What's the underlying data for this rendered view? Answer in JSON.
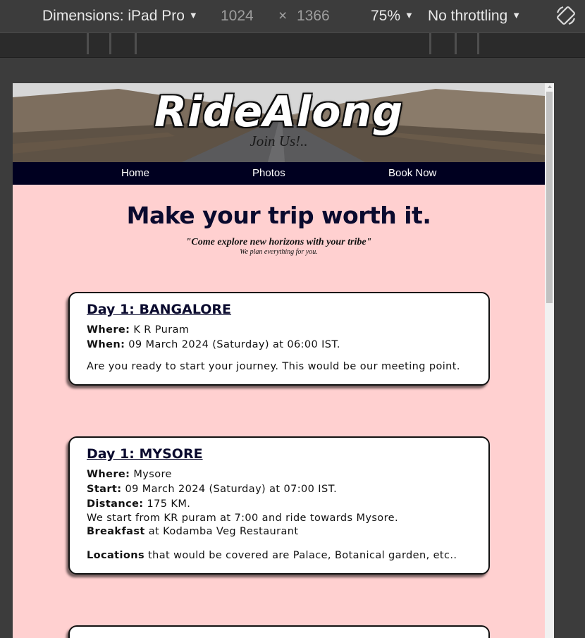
{
  "devtools": {
    "dimensions_label": "Dimensions: iPad Pro",
    "width": "1024",
    "times": "×",
    "height": "1366",
    "zoom": "75%",
    "throttling": "No throttling",
    "caret": "▼"
  },
  "site": {
    "brand": "RideAlong",
    "tagline": "Join Us!..",
    "nav": [
      "Home",
      "Photos",
      "Book Now"
    ],
    "headline": "Make your trip worth it.",
    "quote": "\"Come explore new horizons with your tribe\"",
    "subquote": "We plan everything for you."
  },
  "days": [
    {
      "title": "Day 1: BANGALORE",
      "where_label": "Where:",
      "where": "K R Puram",
      "when_label": "When:",
      "when": "09 March 2024 (Saturday) at 06:00 IST.",
      "note": "Are you ready to start your journey. This would be our meeting point."
    },
    {
      "title": "Day 1: MYSORE",
      "where_label": "Where:",
      "where": "Mysore",
      "start_label": "Start:",
      "start": "09 March 2024 (Saturday) at 07:00 IST.",
      "distance_label": "Distance:",
      "distance": "175 KM.",
      "route": "We start from KR puram at 7:00 and ride towards Mysore.",
      "breakfast_label": "Breakfast",
      "breakfast": "at Kodamba Veg Restaurant",
      "locations_label": "Locations",
      "locations": "that would be covered are Palace, Botanical garden, etc.."
    }
  ]
}
